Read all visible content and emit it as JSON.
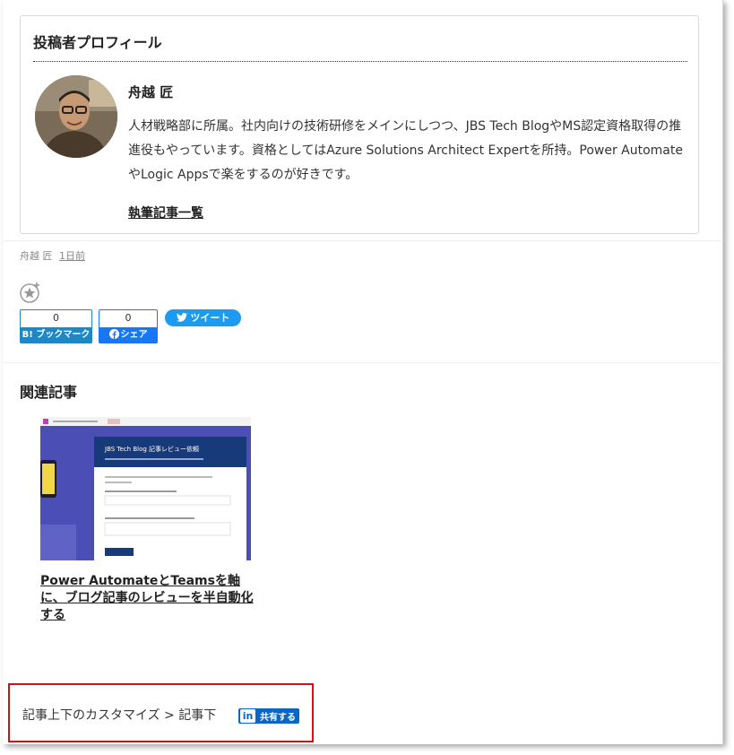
{
  "profile": {
    "heading": "投稿者プロフィール",
    "name": "舟越 匠",
    "bio": "人材戦略部に所属。社内向けの技術研修をメインにしつつ、JBS Tech BlogやMS認定資格取得の推進役もやっています。資格としてはAzure Solutions Architect Expertを所持。Power AutomateやLogic Appsで楽をするのが好きです。",
    "articles_link": "執筆記事一覧"
  },
  "meta": {
    "author": "舟越 匠",
    "date": "1日前"
  },
  "share": {
    "hatena_count": "0",
    "hatena_label": "B! ブックマーク",
    "facebook_count": "0",
    "facebook_label": "シェア",
    "tweet_label": "ツイート"
  },
  "related": {
    "heading": "関連記事",
    "thumbnail_title": "JBS Tech Blog 記事レビュー依頼",
    "article_title": "Power AutomateとTeamsを軸に、ブログ記事のレビューを半自動化する"
  },
  "footer": {
    "breadcrumb": "記事上下のカスタマイズ > 記事下",
    "linkedin_label": "共有する",
    "linkedin_icon": "in"
  },
  "colors": {
    "hatena": "#1e88c7",
    "facebook": "#1877f2",
    "twitter": "#1d9bf0",
    "linkedin": "#0a66c2",
    "highlight": "#d0101c"
  }
}
